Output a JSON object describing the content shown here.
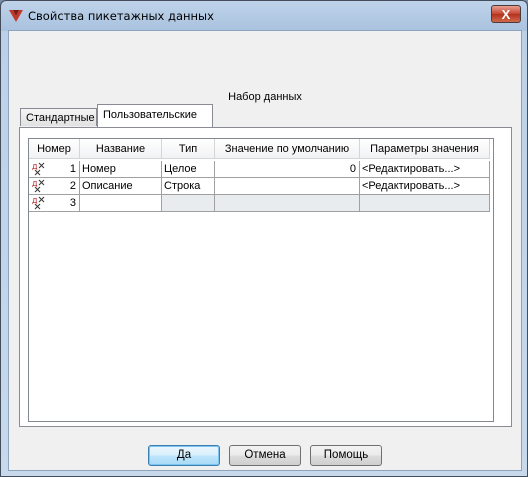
{
  "window": {
    "title": "Свойства пикетажных данных",
    "close_glyph": "X"
  },
  "group": {
    "caption": "Набор данных"
  },
  "tabs": [
    {
      "label": "Стандартные",
      "active": false
    },
    {
      "label": "Пользовательские",
      "active": true
    }
  ],
  "grid": {
    "columns": [
      "Номер",
      "Название",
      "Тип",
      "Значение по умолчанию",
      "Параметры значения"
    ],
    "rows": [
      {
        "num": "1",
        "name": "Номер",
        "type": "Целое",
        "default": "0",
        "params": "<Редактировать...>"
      },
      {
        "num": "2",
        "name": "Описание",
        "type": "Строка",
        "default": "",
        "params": "<Редактировать...>"
      },
      {
        "num": "3",
        "name": "",
        "type": "",
        "default": "",
        "params": ""
      }
    ]
  },
  "buttons": {
    "ok": "Да",
    "cancel": "Отмена",
    "help": "Помощь"
  },
  "colors": {
    "accent": "#3c7fb1",
    "app_icon": "#c0392b",
    "row_icon": "#b22222"
  },
  "icons": {
    "app": "app-logo-icon",
    "row": "table-row-icon"
  }
}
